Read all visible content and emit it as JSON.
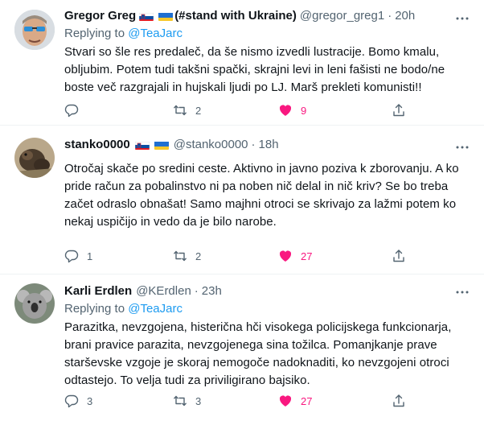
{
  "colors": {
    "accent": "#1d9bf0",
    "like": "#f91880",
    "muted": "#536471",
    "text": "#0f1419"
  },
  "tweets": [
    {
      "avatar_icon": "avatar-sunglasses-man",
      "name": "Gregor Greg",
      "name_suffix": "(#stand with Ukraine)",
      "flags": [
        "slovenia-flag-icon",
        "ukraine-flag-icon"
      ],
      "handle": "@gregor_greg1",
      "time": "20h",
      "replying_label": "Replying to",
      "replying_to": "@TeaJarc",
      "lines": [
        "Stvari so šle res predaleč, da še nismo izvedli lustracije. Bomo kmalu,",
        "obljubim. Potem tudi takšni spački, skrajni levi in leni fašisti ne bodo/ne",
        "boste več razgrajali in hujskali ljudi po LJ. Marš prekleti komunisti!!"
      ],
      "replies": "",
      "retweets": "2",
      "likes": "9"
    },
    {
      "avatar_icon": "avatar-animal",
      "name": "stanko0000",
      "name_suffix": "",
      "flags": [
        "slovenia-flag-icon",
        "ukraine-flag-icon"
      ],
      "handle": "@stanko0000",
      "time": "18h",
      "replying_label": "",
      "replying_to": "",
      "lines": [
        "Otročaj skače po sredini ceste. Aktivno in javno poziva k zborovanju. A ko",
        "pride račun za pobalinstvo ni pa noben nič delal in nič kriv? Se bo treba",
        "začet odraslo obnašat! Samo majhni otroci se skrivajo za lažmi potem ko",
        "nekaj uspičijo in vedo da je bilo narobe."
      ],
      "replies": "1",
      "retweets": "2",
      "likes": "27"
    },
    {
      "avatar_icon": "avatar-koala",
      "name": "Karli Erdlen",
      "name_suffix": "",
      "flags": [],
      "handle": "@KErdlen",
      "time": "23h",
      "replying_label": "Replying to",
      "replying_to": "@TeaJarc",
      "lines": [
        "Parazitka, nevzgojena, histerična hči visokega policijskega funkcionarja,",
        "brani pravice parazita, nevzgojenega sina tožilca. Pomanjkanje prave",
        "starševske vzgoje je skoraj nemogoče nadoknaditi, ko nevzgojeni otroci",
        "odtastejo. To velja tudi za priviligirano bajsiko."
      ],
      "replies": "3",
      "retweets": "3",
      "likes": "27"
    }
  ]
}
